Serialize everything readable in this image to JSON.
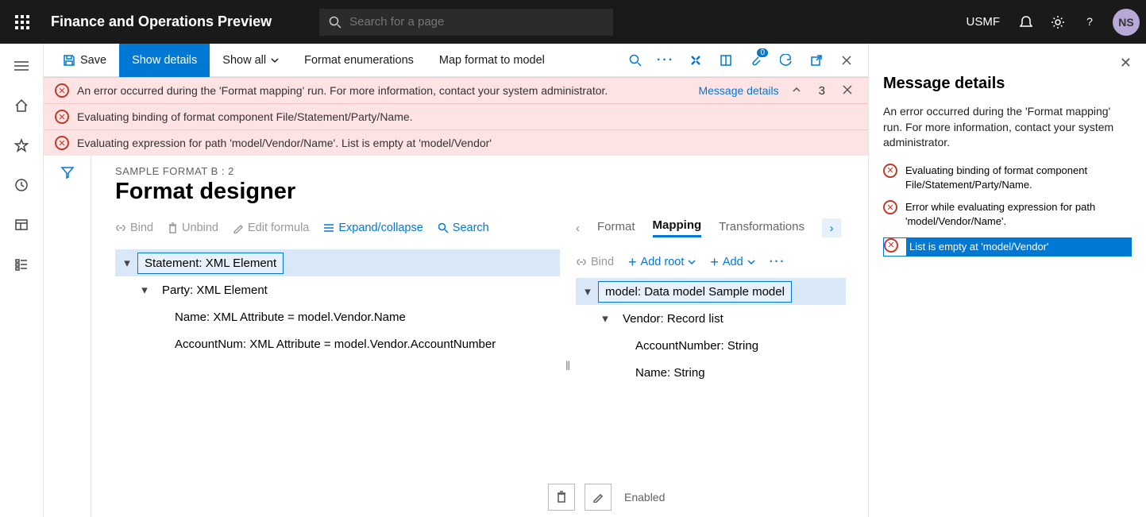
{
  "topbar": {
    "app_title": "Finance and Operations Preview",
    "search_placeholder": "Search for a page",
    "company": "USMF",
    "avatar_initials": "NS"
  },
  "ribbon": {
    "save": "Save",
    "show_details": "Show details",
    "show_all": "Show all",
    "format_enum": "Format enumerations",
    "map_model": "Map format to model",
    "badge_count": "0"
  },
  "banners": {
    "b1": "An error occurred during the 'Format mapping' run. For more information, contact your system administrator.",
    "b2": "Evaluating binding of format component File/Statement/Party/Name.",
    "b3": "Evaluating expression for path 'model/Vendor/Name'.   List is empty at 'model/Vendor'",
    "details_link": "Message details",
    "count": "3"
  },
  "designer": {
    "crumb": "SAMPLE FORMAT B : 2",
    "title": "Format designer",
    "left_toolbar": {
      "bind": "Bind",
      "unbind": "Unbind",
      "edit": "Edit formula",
      "expand": "Expand/collapse",
      "search": "Search"
    },
    "tree": {
      "n0": "Statement: XML Element",
      "n1": "Party: XML Element",
      "n2": "Name: XML Attribute = model.Vendor.Name",
      "n3": "AccountNum: XML Attribute = model.Vendor.AccountNumber"
    },
    "tabs": {
      "format": "Format",
      "mapping": "Mapping",
      "transform": "Transformations"
    },
    "right_toolbar": {
      "bind": "Bind",
      "add_root": "Add root",
      "add": "Add"
    },
    "rtree": {
      "m0": "model: Data model Sample model",
      "m1": "Vendor: Record list",
      "m2": "AccountNumber: String",
      "m3": "Name: String"
    },
    "enabled_label": "Enabled"
  },
  "panel": {
    "title": "Message details",
    "desc": "An error occurred during the 'Format mapping' run. For more information, contact your system administrator.",
    "i1": "Evaluating binding of format component File/Statement/Party/Name.",
    "i2": "Error while evaluating expression for path 'model/Vendor/Name'.",
    "i3": "List is empty at 'model/Vendor'"
  }
}
